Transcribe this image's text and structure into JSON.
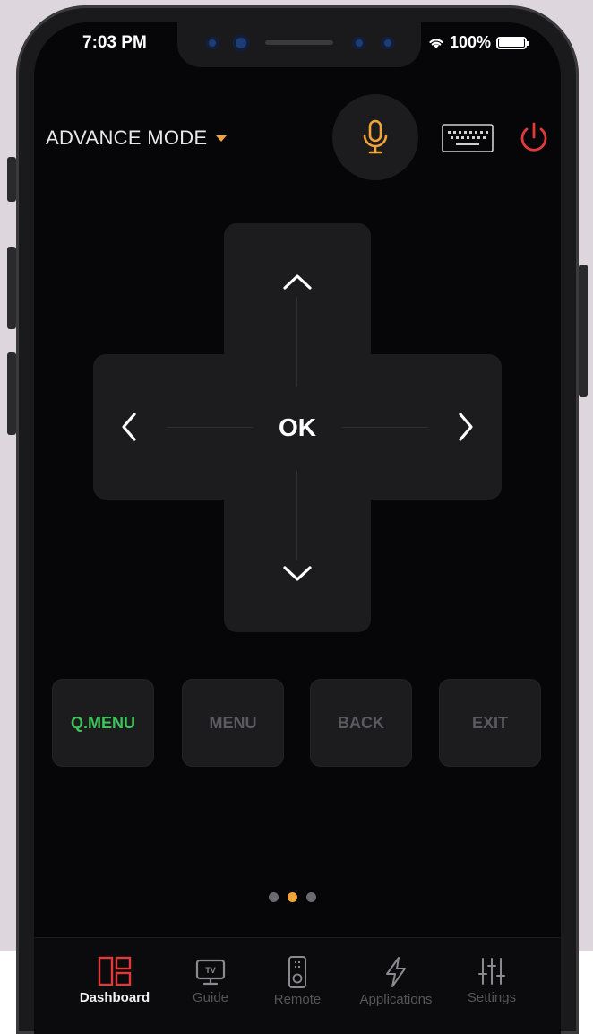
{
  "colors": {
    "accent": "#f2a33a",
    "power": "#e23a3a",
    "qmenu": "#3fc25a",
    "dashboard": "#e23a3a",
    "muted": "#55555a"
  },
  "status_bar": {
    "time": "7:03 PM",
    "battery": "100%"
  },
  "header": {
    "mode_label": "ADVANCE MODE",
    "mic_icon": "microphone-icon",
    "keyboard_icon": "keyboard-icon",
    "power_icon": "power-icon"
  },
  "dpad": {
    "ok_label": "OK"
  },
  "function_buttons": [
    {
      "label": "Q.MENU",
      "active": true
    },
    {
      "label": "MENU",
      "active": false
    },
    {
      "label": "BACK",
      "active": false
    },
    {
      "label": "EXIT",
      "active": false
    }
  ],
  "pager": {
    "pages": 3,
    "current": 2
  },
  "tabs": [
    {
      "label": "Dashboard",
      "icon": "dashboard-icon",
      "active": true
    },
    {
      "label": "Guide",
      "icon": "tv-guide-icon",
      "active": false
    },
    {
      "label": "Remote",
      "icon": "remote-icon",
      "active": false
    },
    {
      "label": "Applications",
      "icon": "lightning-icon",
      "active": false
    },
    {
      "label": "Settings",
      "icon": "sliders-icon",
      "active": false
    }
  ]
}
